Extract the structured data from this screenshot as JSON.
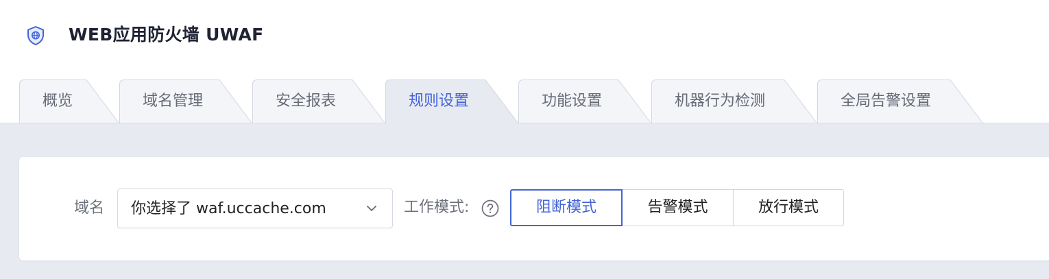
{
  "app": {
    "title": "WEB应用防火墙 UWAF",
    "logo_icon": "shield-globe-icon",
    "accent_color": "#4364d6"
  },
  "tabs": [
    {
      "label": "概览",
      "active": false
    },
    {
      "label": "域名管理",
      "active": false
    },
    {
      "label": "安全报表",
      "active": false
    },
    {
      "label": "规则设置",
      "active": true
    },
    {
      "label": "功能设置",
      "active": false
    },
    {
      "label": "机器行为检测",
      "active": false
    },
    {
      "label": "全局告警设置",
      "active": false
    }
  ],
  "filters": {
    "domain_label": "域名",
    "domain_select": {
      "value": "你选择了 waf.uccache.com",
      "icon": "chevron-down-icon"
    },
    "mode_label": "工作模式:",
    "mode_help_icon": "question-circle-icon",
    "modes": [
      {
        "label": "阻断模式",
        "selected": true
      },
      {
        "label": "告警模式",
        "selected": false
      },
      {
        "label": "放行模式",
        "selected": false
      }
    ]
  }
}
